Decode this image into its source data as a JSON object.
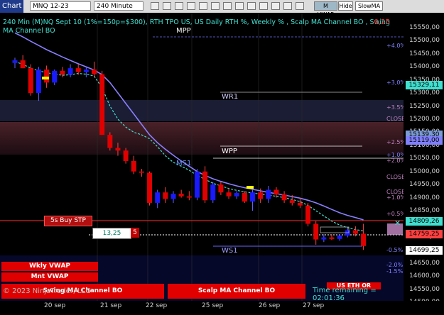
{
  "toolbar": {
    "tab_label": "Chart",
    "instrument": "MNQ 12-23",
    "interval": "240 Minute",
    "buttons": [
      "M VWAP",
      "Hide",
      "SlowMA"
    ]
  },
  "header": {
    "text": "240 Min (M)NQ Sept 10 (1%=150p=$300), RTH TPO US, US Daily RTH %, Weekly % , Scalp MA Channel BO , Swing MA Channel BO",
    "corner_value": "-0,25"
  },
  "levels": {
    "mpp": "MPP",
    "wr1": "WR1",
    "wpp": "WPP",
    "ms1": "MS1",
    "ws1": "WS1",
    "close": "CLOSE"
  },
  "percent_labels": [
    "+4.0%",
    "+3,0%",
    "+3.5%",
    "+2.5%",
    "+1.0%",
    "+2.0%",
    "+1.0%",
    "+0.5%",
    "-0.5%",
    "-2.0%",
    "-1.5%"
  ],
  "order": {
    "label": "5s  Buy STP",
    "qty_value": "13,25",
    "qty_count": "5"
  },
  "signals": {
    "weekly_vwap": "Wkly VWAP",
    "mnt_vwap": "Mnt VWAP",
    "swing_channel": "Swing MA Channel BO",
    "scalp_channel": "Scalp MA Channel BO",
    "eth_label": "US ETH OR"
  },
  "footer": {
    "copyright": "© 2023 NinjaTrader, LLC",
    "time_remaining": "Time remaining = 02:01:36"
  },
  "price_axis": {
    "ticks": [
      "15550,00",
      "15500,00",
      "15450,00",
      "15400,00",
      "15350,00",
      "15300,00",
      "15250,00",
      "15200,00",
      "15150,00",
      "15100,00",
      "15050,00",
      "15000,00",
      "14950,00",
      "14900,00",
      "14850,00",
      "14750,00",
      "14650,00",
      "14600,00",
      "14550,00",
      "14500,00"
    ],
    "markers": [
      {
        "value": "15329,11",
        "color": "#40e0d0"
      },
      {
        "value": "15139,30",
        "color": "#7b9bd6"
      },
      {
        "value": "15119,00",
        "color": "#8080ff"
      },
      {
        "value": "14809,26",
        "color": "#40e0d0"
      },
      {
        "value": "14759,25",
        "color": "#ff4040"
      },
      {
        "value": "14699,25",
        "color": "#ffffff"
      }
    ]
  },
  "time_axis": {
    "labels": [
      "20 sep",
      "21 sep",
      "22 sep",
      "25 sep",
      "26 sep",
      "27 sep"
    ]
  },
  "chart_data": {
    "type": "candlestick",
    "interval": "240 Minute",
    "instrument": "MNQ 12-23",
    "x": [
      "20 sep",
      "21 sep",
      "22 sep",
      "25 sep",
      "26 sep",
      "27 sep"
    ],
    "ylim": [
      14500,
      15580
    ],
    "last_price": 14699.25,
    "candles": [
      {
        "o": 15415,
        "h": 15435,
        "l": 15395,
        "c": 15425
      },
      {
        "o": 15425,
        "h": 15445,
        "l": 15405,
        "c": 15395
      },
      {
        "o": 15395,
        "h": 15410,
        "l": 15290,
        "c": 15300
      },
      {
        "o": 15300,
        "h": 15400,
        "l": 15270,
        "c": 15390
      },
      {
        "o": 15390,
        "h": 15405,
        "l": 15320,
        "c": 15340
      },
      {
        "o": 15340,
        "h": 15390,
        "l": 15330,
        "c": 15385
      },
      {
        "o": 15385,
        "h": 15400,
        "l": 15360,
        "c": 15370
      },
      {
        "o": 15370,
        "h": 15410,
        "l": 15360,
        "c": 15395
      },
      {
        "o": 15395,
        "h": 15410,
        "l": 15370,
        "c": 15380
      },
      {
        "o": 15380,
        "h": 15400,
        "l": 15360,
        "c": 15390
      },
      {
        "o": 15390,
        "h": 15420,
        "l": 15360,
        "c": 15372
      },
      {
        "o": 15372,
        "h": 15385,
        "l": 15140,
        "c": 15140
      },
      {
        "o": 15140,
        "h": 15150,
        "l": 15080,
        "c": 15090
      },
      {
        "o": 15090,
        "h": 15110,
        "l": 15060,
        "c": 15080
      },
      {
        "o": 15080,
        "h": 15090,
        "l": 15030,
        "c": 15040
      },
      {
        "o": 15040,
        "h": 15060,
        "l": 14990,
        "c": 15000
      },
      {
        "o": 15000,
        "h": 15010,
        "l": 14980,
        "c": 14995
      },
      {
        "o": 14995,
        "h": 15000,
        "l": 14870,
        "c": 14880
      },
      {
        "o": 14880,
        "h": 14930,
        "l": 14860,
        "c": 14920
      },
      {
        "o": 14920,
        "h": 14940,
        "l": 14880,
        "c": 14895
      },
      {
        "o": 14895,
        "h": 14925,
        "l": 14880,
        "c": 14915
      },
      {
        "o": 14915,
        "h": 14930,
        "l": 14900,
        "c": 14905
      },
      {
        "o": 14905,
        "h": 14925,
        "l": 14890,
        "c": 14900
      },
      {
        "o": 14900,
        "h": 15010,
        "l": 14890,
        "c": 15000
      },
      {
        "o": 15000,
        "h": 15020,
        "l": 14880,
        "c": 14890
      },
      {
        "o": 14890,
        "h": 14960,
        "l": 14880,
        "c": 14950
      },
      {
        "o": 14950,
        "h": 14960,
        "l": 14910,
        "c": 14920
      },
      {
        "o": 14920,
        "h": 14935,
        "l": 14895,
        "c": 14905
      },
      {
        "o": 14905,
        "h": 14925,
        "l": 14895,
        "c": 14918
      },
      {
        "o": 14918,
        "h": 14925,
        "l": 14880,
        "c": 14885
      },
      {
        "o": 14885,
        "h": 14930,
        "l": 14850,
        "c": 14920
      },
      {
        "o": 14920,
        "h": 14935,
        "l": 14880,
        "c": 14895
      },
      {
        "o": 14895,
        "h": 14945,
        "l": 14880,
        "c": 14930
      },
      {
        "o": 14930,
        "h": 14940,
        "l": 14900,
        "c": 14912
      },
      {
        "o": 14912,
        "h": 14925,
        "l": 14880,
        "c": 14890
      },
      {
        "o": 14890,
        "h": 14910,
        "l": 14870,
        "c": 14880
      },
      {
        "o": 14880,
        "h": 14900,
        "l": 14860,
        "c": 14870
      },
      {
        "o": 14870,
        "h": 14880,
        "l": 14790,
        "c": 14800
      },
      {
        "o": 14800,
        "h": 14810,
        "l": 14720,
        "c": 14740
      },
      {
        "o": 14740,
        "h": 14760,
        "l": 14730,
        "c": 14748
      },
      {
        "o": 14748,
        "h": 14760,
        "l": 14738,
        "c": 14742
      },
      {
        "o": 14742,
        "h": 14760,
        "l": 14735,
        "c": 14755
      },
      {
        "o": 14755,
        "h": 14785,
        "l": 14748,
        "c": 14775
      },
      {
        "o": 14775,
        "h": 14790,
        "l": 14752,
        "c": 14762
      },
      {
        "o": 14762,
        "h": 14800,
        "l": 14700,
        "c": 14715
      }
    ],
    "lines": [
      {
        "name": "Scalp MA Channel",
        "color": "#40e0d0",
        "values": [
          15420,
          15410,
          15395,
          15385,
          15378,
          15372,
          15368,
          15370,
          15375,
          15372,
          15365,
          15320,
          15250,
          15200,
          15170,
          15150,
          15140,
          15125,
          15095,
          15060,
          15035,
          15020,
          15005,
          14985,
          14970,
          14955,
          14945,
          14935,
          14928,
          14922,
          14918,
          14913,
          14910,
          14905,
          14900,
          14893,
          14885,
          14870,
          14850,
          14830,
          14810,
          14795,
          14785,
          14778,
          14772
        ]
      },
      {
        "name": "Swing MA Channel",
        "color": "#8a7fff",
        "values": [
          15530,
          15515,
          15498,
          15482,
          15466,
          15452,
          15438,
          15425,
          15412,
          15400,
          15388,
          15370,
          15340,
          15300,
          15260,
          15220,
          15180,
          15140,
          15110,
          15085,
          15062,
          15040,
          15020,
          15000,
          14985,
          14972,
          14962,
          14953,
          14945,
          14938,
          14932,
          14926,
          14920,
          14915,
          14910,
          14904,
          14898,
          14890,
          14880,
          14868,
          14855,
          14842,
          14832,
          14824,
          14815
        ]
      }
    ]
  }
}
